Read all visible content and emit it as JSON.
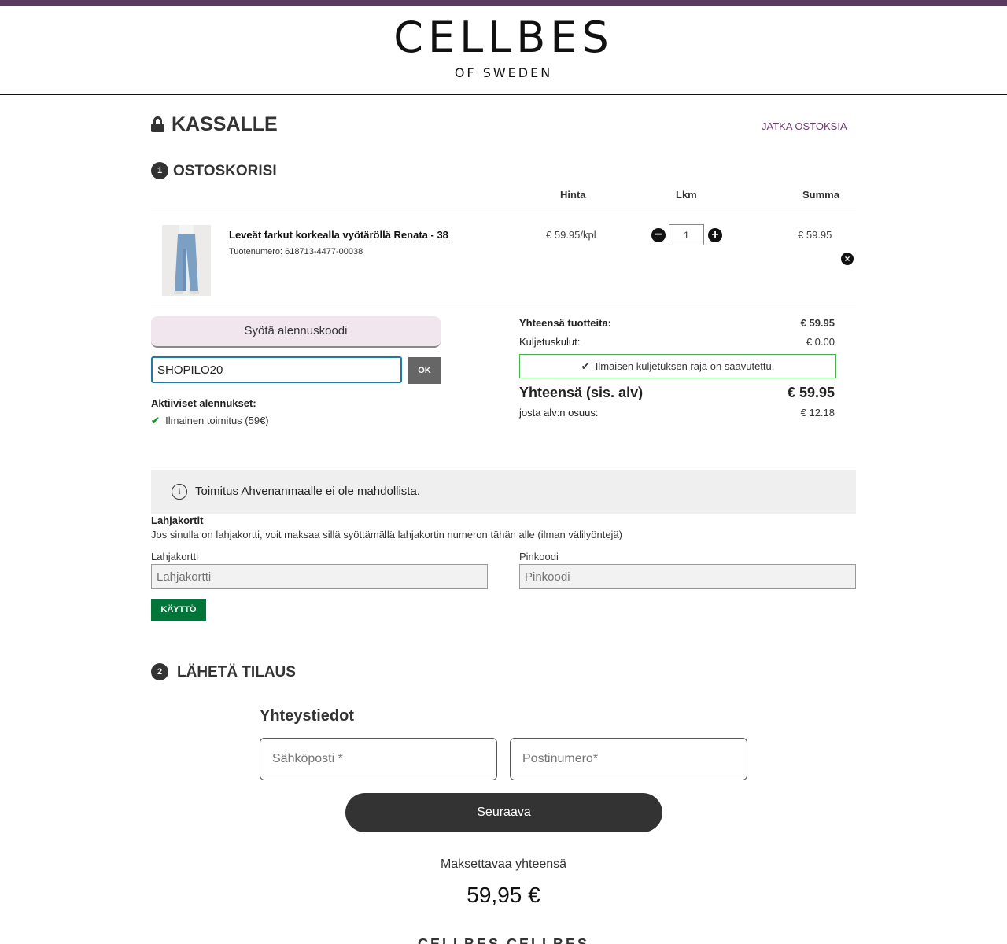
{
  "brand": {
    "logo": "CELLBES",
    "sub": "OF SWEDEN",
    "accent": "#5a3a5e"
  },
  "page_title": "KASSALLE",
  "continue_link": "JATKA OSTOKSIA",
  "cart": {
    "step_number": "1",
    "title": "OSTOSKORISI",
    "columns": {
      "price": "Hinta",
      "qty": "Lkm",
      "total": "Summa"
    },
    "item": {
      "name": "Leveät farkut korkealla vyötäröllä Renata - 38",
      "sku": "Tuotenumero: 618713-4477-00038",
      "unit_price": "€ 59.95/kpl",
      "qty": "1",
      "line_total": "€ 59.95"
    }
  },
  "discount": {
    "toggle_label": "Syötä alennuskoodi",
    "code_value": "SHOPILO20",
    "ok_label": "OK",
    "active_title": "Aktiiviset alennukset:",
    "active_items": [
      "Ilmainen toimitus (59€)"
    ]
  },
  "summary": {
    "products_label": "Yhteensä tuotteita:",
    "products_value": "€ 59.95",
    "shipping_label": "Kuljetuskulut:",
    "shipping_value": "€ 0.00",
    "free_shipping_note": "Ilmaisen kuljetuksen raja on saavutettu.",
    "total_label": "Yhteensä (sis. alv)",
    "total_value": "€ 59.95",
    "vat_label": "josta alv:n osuus:",
    "vat_value": "€ 12.18"
  },
  "notice": "Toimitus Ahvenanmaalle ei ole mahdollista.",
  "giftcard": {
    "title": "Lahjakortit",
    "description": "Jos sinulla on lahjakortti, voit maksaa sillä syöttämällä lahjakortin numeron tähän alle (ilman välilyöntejä)",
    "card_label": "Lahjakortti",
    "card_placeholder": "Lahjakortti",
    "pin_label": "Pinkoodi",
    "pin_placeholder": "Pinkoodi",
    "use_label": "KÄYTTÖ"
  },
  "order": {
    "step_number": "2",
    "title": "LÄHETÄ TILAUS",
    "contact_title": "Yhteystiedot",
    "email_placeholder": "Sähköposti *",
    "zip_placeholder": "Postinumero*",
    "next_label": "Seuraava",
    "pay_label": "Maksettavaa yhteensä",
    "pay_total": "59,95 €"
  },
  "footer": {
    "logos": "CELLBES   CELLBES"
  }
}
